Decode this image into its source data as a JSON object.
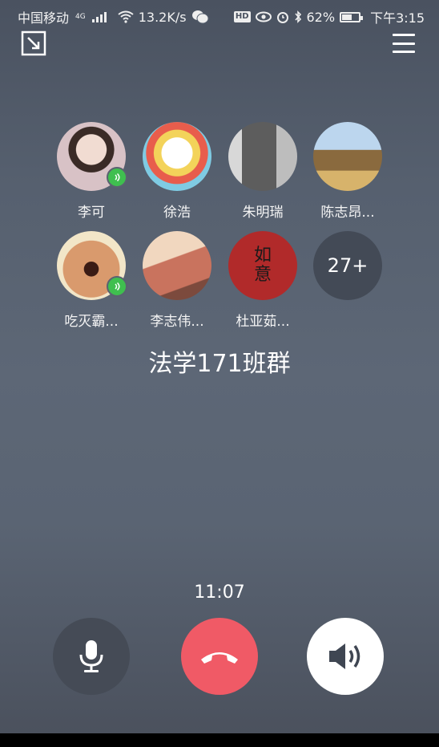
{
  "status_bar": {
    "carrier": "中国移动",
    "network_type": "4G",
    "speed": "13.2K/s",
    "hd_label": "HD",
    "battery": "62%",
    "battery_level": 0.62,
    "time": "下午3:15"
  },
  "call": {
    "group_name": "法学171班群",
    "duration": "11:07"
  },
  "members": [
    {
      "name": "李可",
      "speaking": true,
      "color": "#c9a9a4"
    },
    {
      "name": "徐浩",
      "speaking": false,
      "color": "#e6c97a"
    },
    {
      "name": "朱明瑞",
      "speaking": false,
      "color": "#8b8b8b"
    },
    {
      "name": "陈志昂...",
      "speaking": false,
      "color": "#b99a6c"
    },
    {
      "name": "吃灭霸...",
      "speaking": true,
      "color": "#c08a5e"
    },
    {
      "name": "李志伟...",
      "speaking": false,
      "color": "#c98a70"
    },
    {
      "name": "杜亚茹...",
      "speaking": false,
      "color": "#b12a2a"
    }
  ],
  "more_count": "27+",
  "controls": {
    "mute_icon": "microphone-icon",
    "hangup_icon": "hangup-icon",
    "speaker_icon": "speaker-icon",
    "hangup_color": "#f05a66"
  }
}
